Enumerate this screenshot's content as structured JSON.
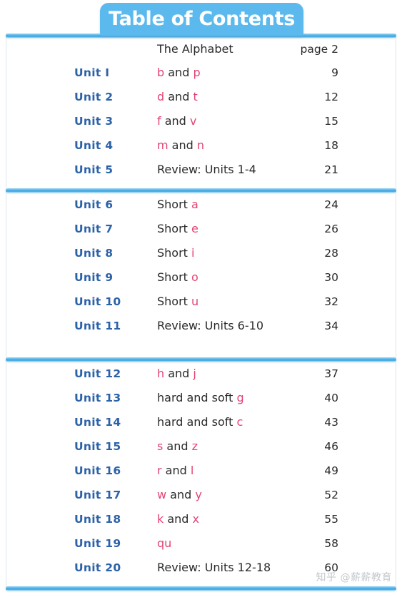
{
  "header": {
    "title": "Table of Contents"
  },
  "colors": {
    "banner_blue": "#5CB9EE",
    "rule_blue": "#4FB0E8",
    "unit_label_blue": "#2C62A8",
    "highlight_pink": "#E24472",
    "body_text": "#2B2B2B"
  },
  "sections": [
    {
      "rows": [
        {
          "unit": "",
          "topic_prefix": "The Alphabet",
          "topic_mid": "",
          "topic_highlight_a": "",
          "topic_highlight_b": "",
          "page": "page 2"
        },
        {
          "unit": "Unit I",
          "topic_prefix": "",
          "topic_highlight_a": "b",
          "topic_mid": " and ",
          "topic_highlight_b": "p",
          "page": "9"
        },
        {
          "unit": "Unit 2",
          "topic_prefix": "",
          "topic_highlight_a": "d",
          "topic_mid": " and ",
          "topic_highlight_b": "t",
          "page": "12"
        },
        {
          "unit": "Unit 3",
          "topic_prefix": "",
          "topic_highlight_a": "f",
          "topic_mid": " and ",
          "topic_highlight_b": "v",
          "page": "15"
        },
        {
          "unit": "Unit 4",
          "topic_prefix": "",
          "topic_highlight_a": "m",
          "topic_mid": " and ",
          "topic_highlight_b": "n",
          "page": "18"
        },
        {
          "unit": "Unit 5",
          "topic_prefix": "Review: Units 1-4",
          "topic_highlight_a": "",
          "topic_mid": "",
          "topic_highlight_b": "",
          "page": "21"
        }
      ]
    },
    {
      "rows": [
        {
          "unit": "Unit 6",
          "topic_prefix": "Short ",
          "topic_highlight_a": "a",
          "topic_mid": "",
          "topic_highlight_b": "",
          "page": "24"
        },
        {
          "unit": "Unit 7",
          "topic_prefix": "Short ",
          "topic_highlight_a": "e",
          "topic_mid": "",
          "topic_highlight_b": "",
          "page": "26"
        },
        {
          "unit": "Unit 8",
          "topic_prefix": "Short ",
          "topic_highlight_a": "i",
          "topic_mid": "",
          "topic_highlight_b": "",
          "page": "28"
        },
        {
          "unit": "Unit 9",
          "topic_prefix": "Short ",
          "topic_highlight_a": "o",
          "topic_mid": "",
          "topic_highlight_b": "",
          "page": "30"
        },
        {
          "unit": "Unit 10",
          "topic_prefix": "Short ",
          "topic_highlight_a": "u",
          "topic_mid": "",
          "topic_highlight_b": "",
          "page": "32"
        },
        {
          "unit": "Unit 11",
          "topic_prefix": "Review: Units 6-10",
          "topic_highlight_a": "",
          "topic_mid": "",
          "topic_highlight_b": "",
          "page": "34"
        }
      ]
    },
    {
      "rows": [
        {
          "unit": "Unit 12",
          "topic_prefix": "",
          "topic_highlight_a": "h",
          "topic_mid": " and ",
          "topic_highlight_b": "j",
          "page": "37"
        },
        {
          "unit": "Unit 13",
          "topic_prefix": "hard and soft ",
          "topic_highlight_a": "g",
          "topic_mid": "",
          "topic_highlight_b": "",
          "page": "40"
        },
        {
          "unit": "Unit 14",
          "topic_prefix": "hard and soft ",
          "topic_highlight_a": "c",
          "topic_mid": "",
          "topic_highlight_b": "",
          "page": "43"
        },
        {
          "unit": "Unit 15",
          "topic_prefix": "",
          "topic_highlight_a": "s",
          "topic_mid": " and ",
          "topic_highlight_b": "z",
          "page": "46"
        },
        {
          "unit": "Unit 16",
          "topic_prefix": "",
          "topic_highlight_a": "r",
          "topic_mid": " and ",
          "topic_highlight_b": "l",
          "page": "49"
        },
        {
          "unit": "Unit 17",
          "topic_prefix": "",
          "topic_highlight_a": "w",
          "topic_mid": " and ",
          "topic_highlight_b": "y",
          "page": "52"
        },
        {
          "unit": "Unit 18",
          "topic_prefix": "",
          "topic_highlight_a": "k",
          "topic_mid": " and ",
          "topic_highlight_b": "x",
          "page": "55"
        },
        {
          "unit": "Unit 19",
          "topic_prefix": "",
          "topic_highlight_a": "qu",
          "topic_mid": "",
          "topic_highlight_b": "",
          "page": "58"
        },
        {
          "unit": "Unit 20",
          "topic_prefix": "Review: Units 12-18",
          "topic_highlight_a": "",
          "topic_mid": "",
          "topic_highlight_b": "",
          "page": "60"
        }
      ]
    }
  ],
  "watermark": {
    "text": "知乎 @薪薪教育"
  }
}
